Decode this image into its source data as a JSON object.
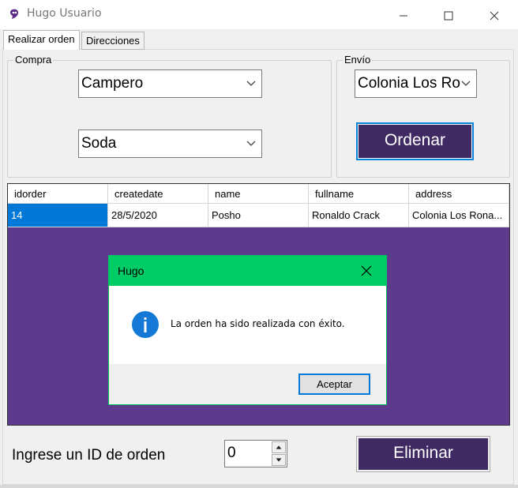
{
  "window": {
    "title": "Hugo Usuario",
    "minimize_icon": "minimize-icon",
    "maximize_icon": "maximize-icon",
    "close_icon": "close-icon"
  },
  "tabs": [
    {
      "label": "Realizar orden",
      "active": true
    },
    {
      "label": "Direcciones",
      "active": false
    }
  ],
  "compra": {
    "label": "Compra",
    "combo1_value": "Campero",
    "combo2_value": "Soda"
  },
  "envio": {
    "label": "Envío",
    "combo_value": "Colonia Los Ro",
    "ordenar_label": "Ordenar"
  },
  "grid": {
    "columns": [
      "idorder",
      "createdate",
      "name",
      "fullname",
      "address"
    ],
    "rows": [
      [
        "14",
        "28/5/2020",
        "Posho",
        "Ronaldo Crack",
        "Colonia Los Rona..."
      ]
    ],
    "background": "#5e3a8c",
    "selected_color": "#0078d7"
  },
  "dialog": {
    "title": "Hugo",
    "message": "La orden ha sido realizada con éxito.",
    "button": "Aceptar",
    "icon": "info-icon",
    "accent": "#00cc66"
  },
  "bottom": {
    "id_label": "Ingrese un ID de orden",
    "spinner_value": "0",
    "eliminar_label": "Eliminar"
  },
  "colors": {
    "button_purple": "#3f2a63",
    "focus_blue": "#0a84d8"
  }
}
